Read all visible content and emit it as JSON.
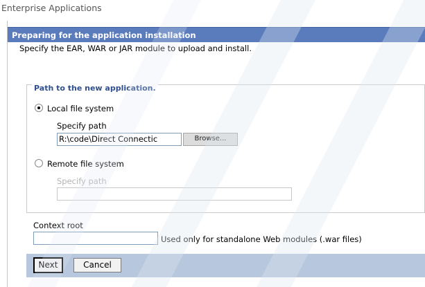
{
  "app": {
    "title": "Enterprise Applications"
  },
  "panel": {
    "header": "Preparing for the application installation",
    "intro": "Specify the EAR, WAR or JAR module to upload and install."
  },
  "path_group": {
    "legend": "Path to the new application.",
    "local": {
      "label": "Local file system",
      "selected": true,
      "specify_label": "Specify path",
      "path_value": "R:\\code\\Direct Connectic",
      "browse_label": "Browse..."
    },
    "remote": {
      "label": "Remote file system",
      "selected": false,
      "specify_label": "Specify path",
      "path_value": ""
    }
  },
  "context_root": {
    "label": "Context root",
    "value": "",
    "hint": "Used only for standalone Web modules (.war files)"
  },
  "buttons": {
    "next": "Next",
    "cancel": "Cancel"
  },
  "colors": {
    "header_bg": "#5b7cbc",
    "footer_bg": "#b7c7dd",
    "legend_text": "#2f4f8f"
  }
}
